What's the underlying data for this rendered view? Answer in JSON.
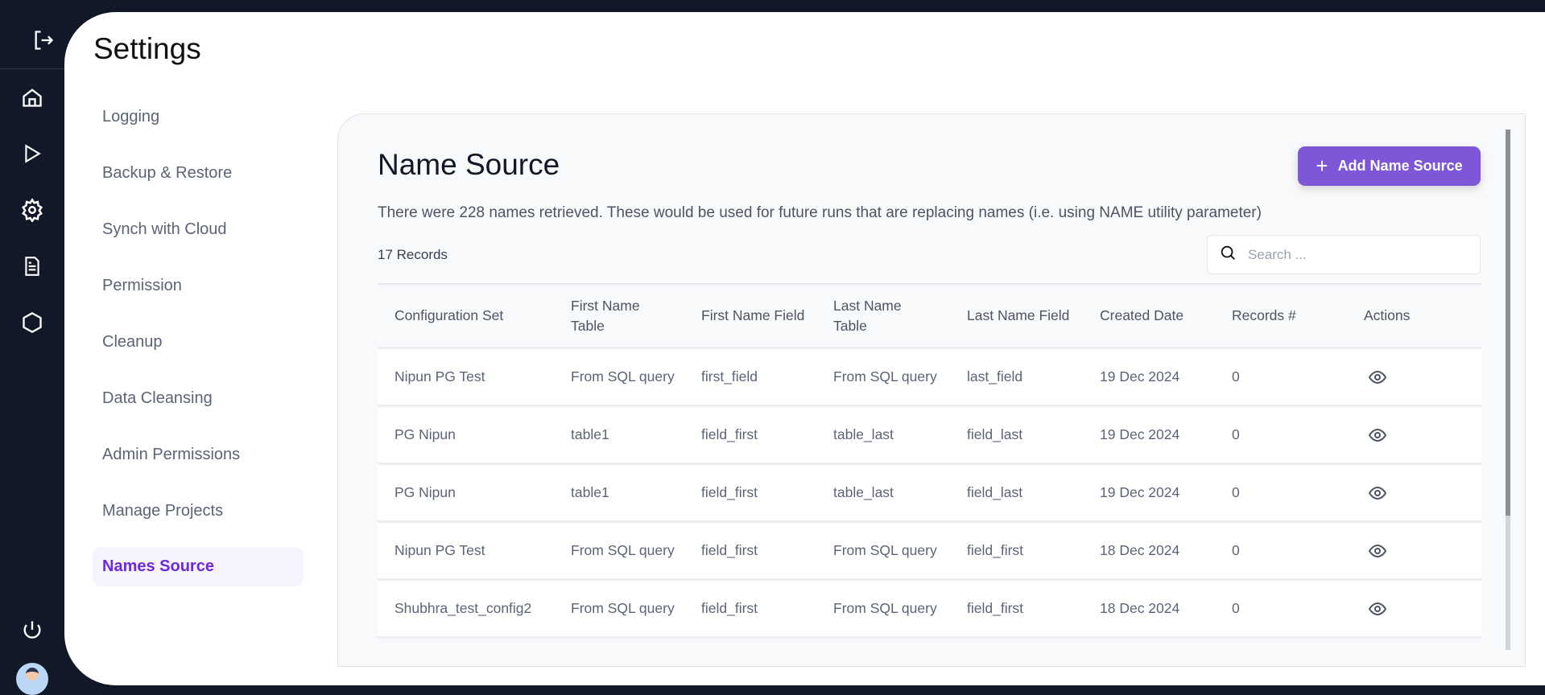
{
  "rail": {
    "icons": [
      "logout-icon",
      "home-icon",
      "play-icon",
      "gear-icon",
      "document-icon",
      "hexagon-icon",
      "power-icon",
      "avatar"
    ]
  },
  "page_title": "Settings",
  "menu": [
    {
      "label": "Logging"
    },
    {
      "label": "Backup & Restore"
    },
    {
      "label": "Synch with Cloud"
    },
    {
      "label": "Permission"
    },
    {
      "label": "Cleanup"
    },
    {
      "label": "Data Cleansing"
    },
    {
      "label": "Admin Permissions"
    },
    {
      "label": "Manage Projects"
    },
    {
      "label": "Names Source",
      "active": true
    }
  ],
  "card": {
    "title": "Name Source",
    "add_button": "Add Name Source",
    "description": "There were 228 names retrieved. These would be used for future runs that are replacing names (i.e. using NAME utility parameter)",
    "records": "17 Records",
    "search_placeholder": "Search ..."
  },
  "accent": "#7e57d8",
  "table": {
    "headers": [
      "Configuration Set",
      "First Name Table",
      "First Name Field",
      "Last Name Table",
      "Last Name Field",
      "Created Date",
      "Records #",
      "Actions"
    ],
    "rows": [
      [
        "Nipun PG Test",
        "From SQL query",
        "first_field",
        "From SQL query",
        "last_field",
        "19 Dec 2024",
        "0"
      ],
      [
        "PG Nipun",
        "table1",
        "field_first",
        "table_last",
        "field_last",
        "19 Dec 2024",
        "0"
      ],
      [
        "PG Nipun",
        "table1",
        "field_first",
        "table_last",
        "field_last",
        "19 Dec 2024",
        "0"
      ],
      [
        "Nipun PG Test",
        "From SQL query",
        "field_first",
        "From SQL query",
        "field_first",
        "18 Dec 2024",
        "0"
      ],
      [
        "Shubhra_test_config2",
        "From SQL query",
        "field_first",
        "From SQL query",
        "field_first",
        "18 Dec 2024",
        "0"
      ]
    ]
  }
}
